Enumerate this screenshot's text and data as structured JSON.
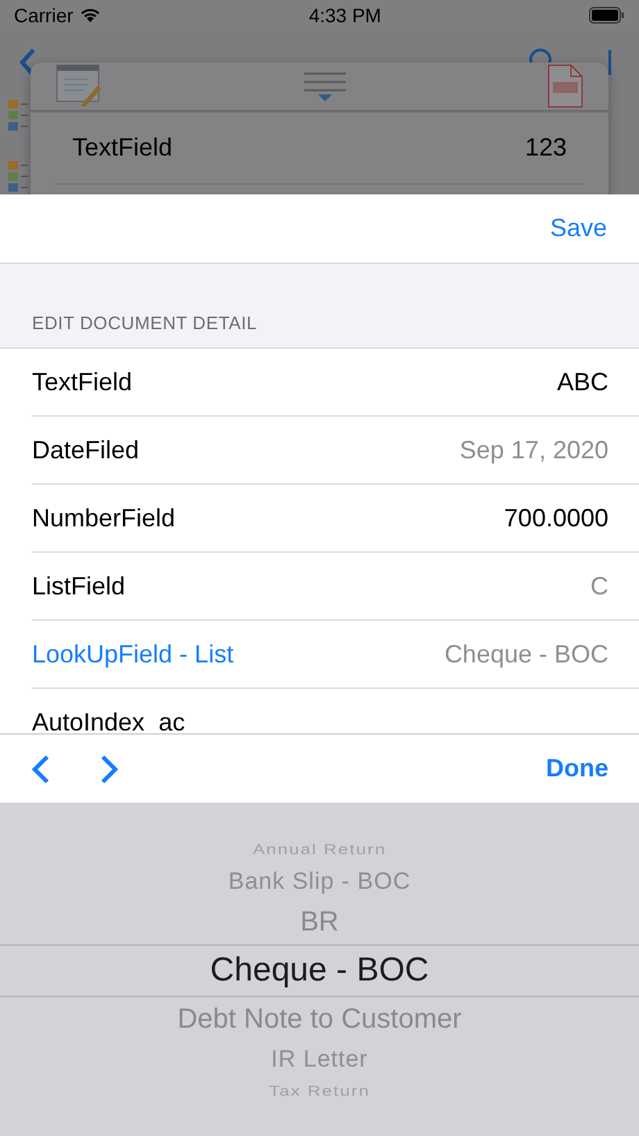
{
  "status_bar": {
    "carrier": "Carrier",
    "time": "4:33 PM"
  },
  "popup": {
    "row": {
      "label": "TextField",
      "value": "123"
    }
  },
  "sheet": {
    "save": "Save",
    "section": "EDIT DOCUMENT DETAIL",
    "fields": [
      {
        "kind": "plain",
        "label": "TextField",
        "value": "ABC",
        "dimmed": false
      },
      {
        "kind": "plain",
        "label": "DateFiled",
        "value": "Sep 17, 2020",
        "dimmed": true
      },
      {
        "kind": "plain",
        "label": "NumberField",
        "value": "700.0000",
        "dimmed": false
      },
      {
        "kind": "plain",
        "label": "ListField",
        "value": "C",
        "dimmed": true
      },
      {
        "kind": "lookup",
        "label": "LookUpField - List",
        "value": "Cheque - BOC",
        "dimmed": true
      },
      {
        "kind": "plain",
        "label": "AutoIndex_ac"
      }
    ]
  },
  "toolbar": {
    "done": "Done"
  },
  "picker": [
    {
      "label": "Annual Return",
      "selected": false
    },
    {
      "label": "Bank Slip - BOC",
      "selected": false
    },
    {
      "label": "BR",
      "selected": false
    },
    {
      "label": "Cheque - BOC",
      "selected": true
    },
    {
      "label": "Debt Note to Customer",
      "selected": false
    },
    {
      "label": "IR Letter",
      "selected": false
    },
    {
      "label": "Tax Return",
      "selected": false
    }
  ]
}
